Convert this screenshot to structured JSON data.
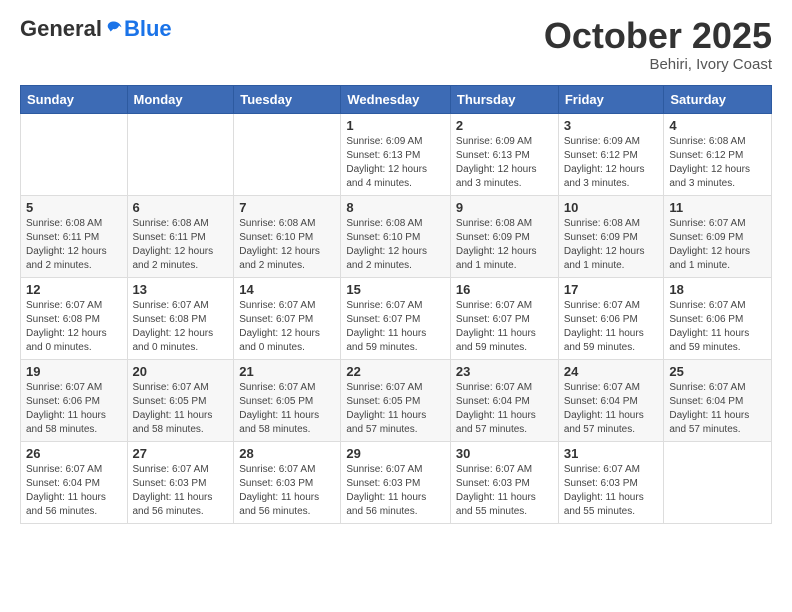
{
  "header": {
    "logo_general": "General",
    "logo_blue": "Blue",
    "month": "October 2025",
    "location": "Behiri, Ivory Coast"
  },
  "weekdays": [
    "Sunday",
    "Monday",
    "Tuesday",
    "Wednesday",
    "Thursday",
    "Friday",
    "Saturday"
  ],
  "weeks": [
    [
      {
        "day": "",
        "info": ""
      },
      {
        "day": "",
        "info": ""
      },
      {
        "day": "",
        "info": ""
      },
      {
        "day": "1",
        "info": "Sunrise: 6:09 AM\nSunset: 6:13 PM\nDaylight: 12 hours\nand 4 minutes."
      },
      {
        "day": "2",
        "info": "Sunrise: 6:09 AM\nSunset: 6:13 PM\nDaylight: 12 hours\nand 3 minutes."
      },
      {
        "day": "3",
        "info": "Sunrise: 6:09 AM\nSunset: 6:12 PM\nDaylight: 12 hours\nand 3 minutes."
      },
      {
        "day": "4",
        "info": "Sunrise: 6:08 AM\nSunset: 6:12 PM\nDaylight: 12 hours\nand 3 minutes."
      }
    ],
    [
      {
        "day": "5",
        "info": "Sunrise: 6:08 AM\nSunset: 6:11 PM\nDaylight: 12 hours\nand 2 minutes."
      },
      {
        "day": "6",
        "info": "Sunrise: 6:08 AM\nSunset: 6:11 PM\nDaylight: 12 hours\nand 2 minutes."
      },
      {
        "day": "7",
        "info": "Sunrise: 6:08 AM\nSunset: 6:10 PM\nDaylight: 12 hours\nand 2 minutes."
      },
      {
        "day": "8",
        "info": "Sunrise: 6:08 AM\nSunset: 6:10 PM\nDaylight: 12 hours\nand 2 minutes."
      },
      {
        "day": "9",
        "info": "Sunrise: 6:08 AM\nSunset: 6:09 PM\nDaylight: 12 hours\nand 1 minute."
      },
      {
        "day": "10",
        "info": "Sunrise: 6:08 AM\nSunset: 6:09 PM\nDaylight: 12 hours\nand 1 minute."
      },
      {
        "day": "11",
        "info": "Sunrise: 6:07 AM\nSunset: 6:09 PM\nDaylight: 12 hours\nand 1 minute."
      }
    ],
    [
      {
        "day": "12",
        "info": "Sunrise: 6:07 AM\nSunset: 6:08 PM\nDaylight: 12 hours\nand 0 minutes."
      },
      {
        "day": "13",
        "info": "Sunrise: 6:07 AM\nSunset: 6:08 PM\nDaylight: 12 hours\nand 0 minutes."
      },
      {
        "day": "14",
        "info": "Sunrise: 6:07 AM\nSunset: 6:07 PM\nDaylight: 12 hours\nand 0 minutes."
      },
      {
        "day": "15",
        "info": "Sunrise: 6:07 AM\nSunset: 6:07 PM\nDaylight: 11 hours\nand 59 minutes."
      },
      {
        "day": "16",
        "info": "Sunrise: 6:07 AM\nSunset: 6:07 PM\nDaylight: 11 hours\nand 59 minutes."
      },
      {
        "day": "17",
        "info": "Sunrise: 6:07 AM\nSunset: 6:06 PM\nDaylight: 11 hours\nand 59 minutes."
      },
      {
        "day": "18",
        "info": "Sunrise: 6:07 AM\nSunset: 6:06 PM\nDaylight: 11 hours\nand 59 minutes."
      }
    ],
    [
      {
        "day": "19",
        "info": "Sunrise: 6:07 AM\nSunset: 6:06 PM\nDaylight: 11 hours\nand 58 minutes."
      },
      {
        "day": "20",
        "info": "Sunrise: 6:07 AM\nSunset: 6:05 PM\nDaylight: 11 hours\nand 58 minutes."
      },
      {
        "day": "21",
        "info": "Sunrise: 6:07 AM\nSunset: 6:05 PM\nDaylight: 11 hours\nand 58 minutes."
      },
      {
        "day": "22",
        "info": "Sunrise: 6:07 AM\nSunset: 6:05 PM\nDaylight: 11 hours\nand 57 minutes."
      },
      {
        "day": "23",
        "info": "Sunrise: 6:07 AM\nSunset: 6:04 PM\nDaylight: 11 hours\nand 57 minutes."
      },
      {
        "day": "24",
        "info": "Sunrise: 6:07 AM\nSunset: 6:04 PM\nDaylight: 11 hours\nand 57 minutes."
      },
      {
        "day": "25",
        "info": "Sunrise: 6:07 AM\nSunset: 6:04 PM\nDaylight: 11 hours\nand 57 minutes."
      }
    ],
    [
      {
        "day": "26",
        "info": "Sunrise: 6:07 AM\nSunset: 6:04 PM\nDaylight: 11 hours\nand 56 minutes."
      },
      {
        "day": "27",
        "info": "Sunrise: 6:07 AM\nSunset: 6:03 PM\nDaylight: 11 hours\nand 56 minutes."
      },
      {
        "day": "28",
        "info": "Sunrise: 6:07 AM\nSunset: 6:03 PM\nDaylight: 11 hours\nand 56 minutes."
      },
      {
        "day": "29",
        "info": "Sunrise: 6:07 AM\nSunset: 6:03 PM\nDaylight: 11 hours\nand 56 minutes."
      },
      {
        "day": "30",
        "info": "Sunrise: 6:07 AM\nSunset: 6:03 PM\nDaylight: 11 hours\nand 55 minutes."
      },
      {
        "day": "31",
        "info": "Sunrise: 6:07 AM\nSunset: 6:03 PM\nDaylight: 11 hours\nand 55 minutes."
      },
      {
        "day": "",
        "info": ""
      }
    ]
  ]
}
